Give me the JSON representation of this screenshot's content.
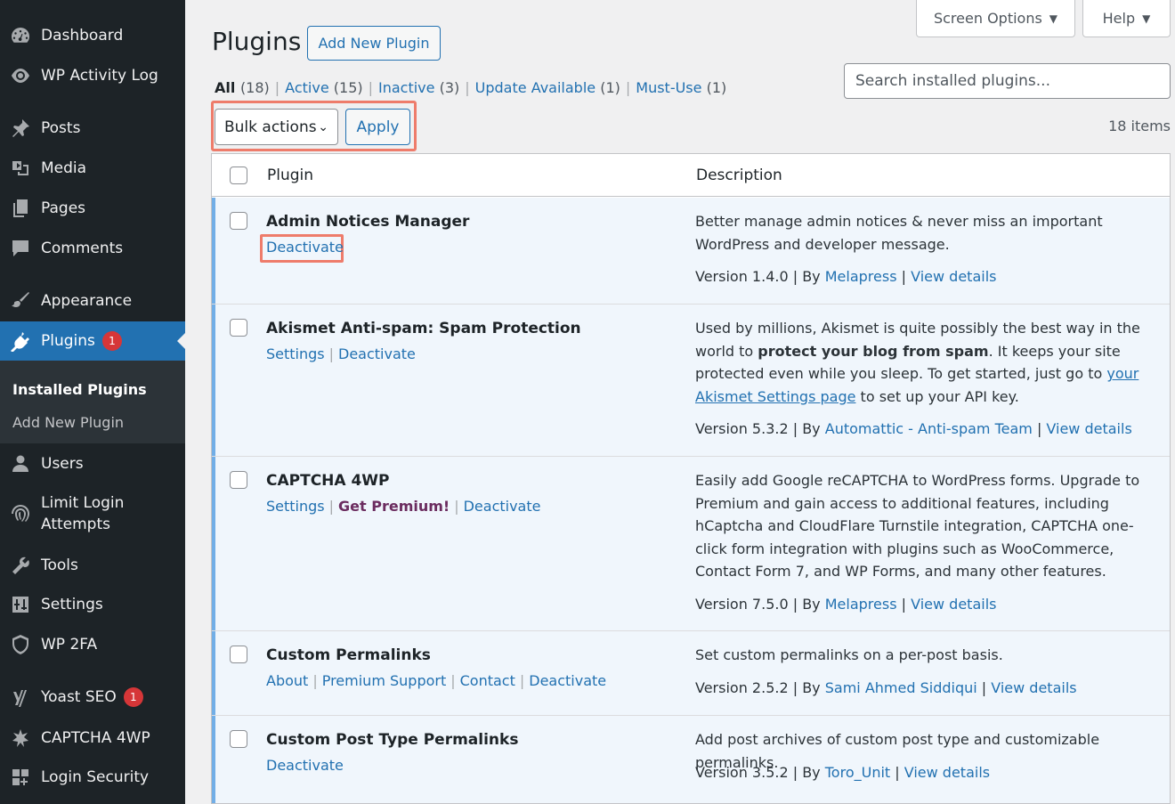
{
  "sidebar": {
    "items": [
      {
        "label": "Dashboard",
        "icon": "dashboard-icon"
      },
      {
        "label": "WP Activity Log",
        "icon": "eye-icon"
      },
      {
        "label": "Posts",
        "icon": "pin-icon"
      },
      {
        "label": "Media",
        "icon": "media-icon"
      },
      {
        "label": "Pages",
        "icon": "pages-icon"
      },
      {
        "label": "Comments",
        "icon": "comment-icon"
      },
      {
        "label": "Appearance",
        "icon": "brush-icon"
      },
      {
        "label": "Plugins",
        "icon": "plugin-icon",
        "badge": "1"
      },
      {
        "label": "Users",
        "icon": "user-icon"
      },
      {
        "label": "Limit Login\nAttempts",
        "icon": "fingerprint-icon"
      },
      {
        "label": "Tools",
        "icon": "wrench-icon"
      },
      {
        "label": "Settings",
        "icon": "settings-icon"
      },
      {
        "label": "WP 2FA",
        "icon": "shield-icon"
      },
      {
        "label": "Yoast SEO",
        "icon": "yoast-icon",
        "badge": "1"
      },
      {
        "label": "CAPTCHA 4WP",
        "icon": "captcha-icon"
      },
      {
        "label": "Login Security",
        "icon": "login-security-icon"
      }
    ],
    "submenu": {
      "current": "Installed Plugins",
      "other": "Add New Plugin"
    }
  },
  "header": {
    "screen_options": "Screen Options",
    "help": "Help",
    "title": "Plugins",
    "add_new": "Add New Plugin"
  },
  "filters": {
    "all": "All",
    "all_count": "(18)",
    "active": "Active",
    "active_count": "(15)",
    "inactive": "Inactive",
    "inactive_count": "(3)",
    "update": "Update Available",
    "update_count": "(1)",
    "mustuse": "Must-Use",
    "mustuse_count": "(1)",
    "sep": "|"
  },
  "search": {
    "placeholder": "Search installed plugins..."
  },
  "bulk": {
    "label": "Bulk actions",
    "apply": "Apply",
    "items_count": "18 items"
  },
  "table": {
    "col_plugin": "Plugin",
    "col_description": "Description",
    "rows": [
      {
        "name": "Admin Notices Manager",
        "actions": [
          "Deactivate"
        ],
        "desc": "Better manage admin notices & never miss an important WordPress and developer message.",
        "version": "Version 1.4.0",
        "by": "By",
        "author": "Melapress",
        "view": "View details"
      },
      {
        "name": "Akismet Anti-spam: Spam Protection",
        "actions": [
          "Settings",
          "Deactivate"
        ],
        "desc_a": "Used by millions, Akismet is quite possibly the best way in the world to ",
        "desc_b": "protect your blog from spam",
        "desc_c": ". It keeps your site protected even while you sleep. To get started, just go to ",
        "desc_link": "your Akismet Settings page",
        "desc_d": " to set up your API key.",
        "version": "Version 5.3.2",
        "by": "By",
        "author": "Automattic - Anti-spam Team",
        "view": "View details"
      },
      {
        "name": "CAPTCHA 4WP",
        "actions": [
          "Settings",
          "Get Premium!",
          "Deactivate"
        ],
        "desc": "Easily add Google reCAPTCHA to WordPress forms. Upgrade to Premium and gain access to additional features, including hCaptcha and CloudFlare Turnstile integration, CAPTCHA one-click form integration with plugins such as WooCommerce, Contact Form 7, and WP Forms, and many other features.",
        "version": "Version 7.5.0",
        "by": "By",
        "author": "Melapress",
        "view": "View details"
      },
      {
        "name": "Custom Permalinks",
        "actions": [
          "About",
          "Premium Support",
          "Contact",
          "Deactivate"
        ],
        "desc": "Set custom permalinks on a per-post basis.",
        "version": "Version 2.5.2",
        "by": "By",
        "author": "Sami Ahmed Siddiqui",
        "view": "View details"
      },
      {
        "name": "Custom Post Type Permalinks",
        "actions": [
          "Deactivate"
        ],
        "desc": "Add post archives of custom post type and customizable permalinks.",
        "version": "Version 3.5.2",
        "by": "By",
        "author": "Toro_Unit",
        "view": "View details"
      }
    ]
  },
  "colors": {
    "sidebar_bg": "#1d2327",
    "accent": "#2271b1",
    "active_row": "#f0f6fc",
    "highlight": "#ee7c6b",
    "badge": "#d63638"
  }
}
